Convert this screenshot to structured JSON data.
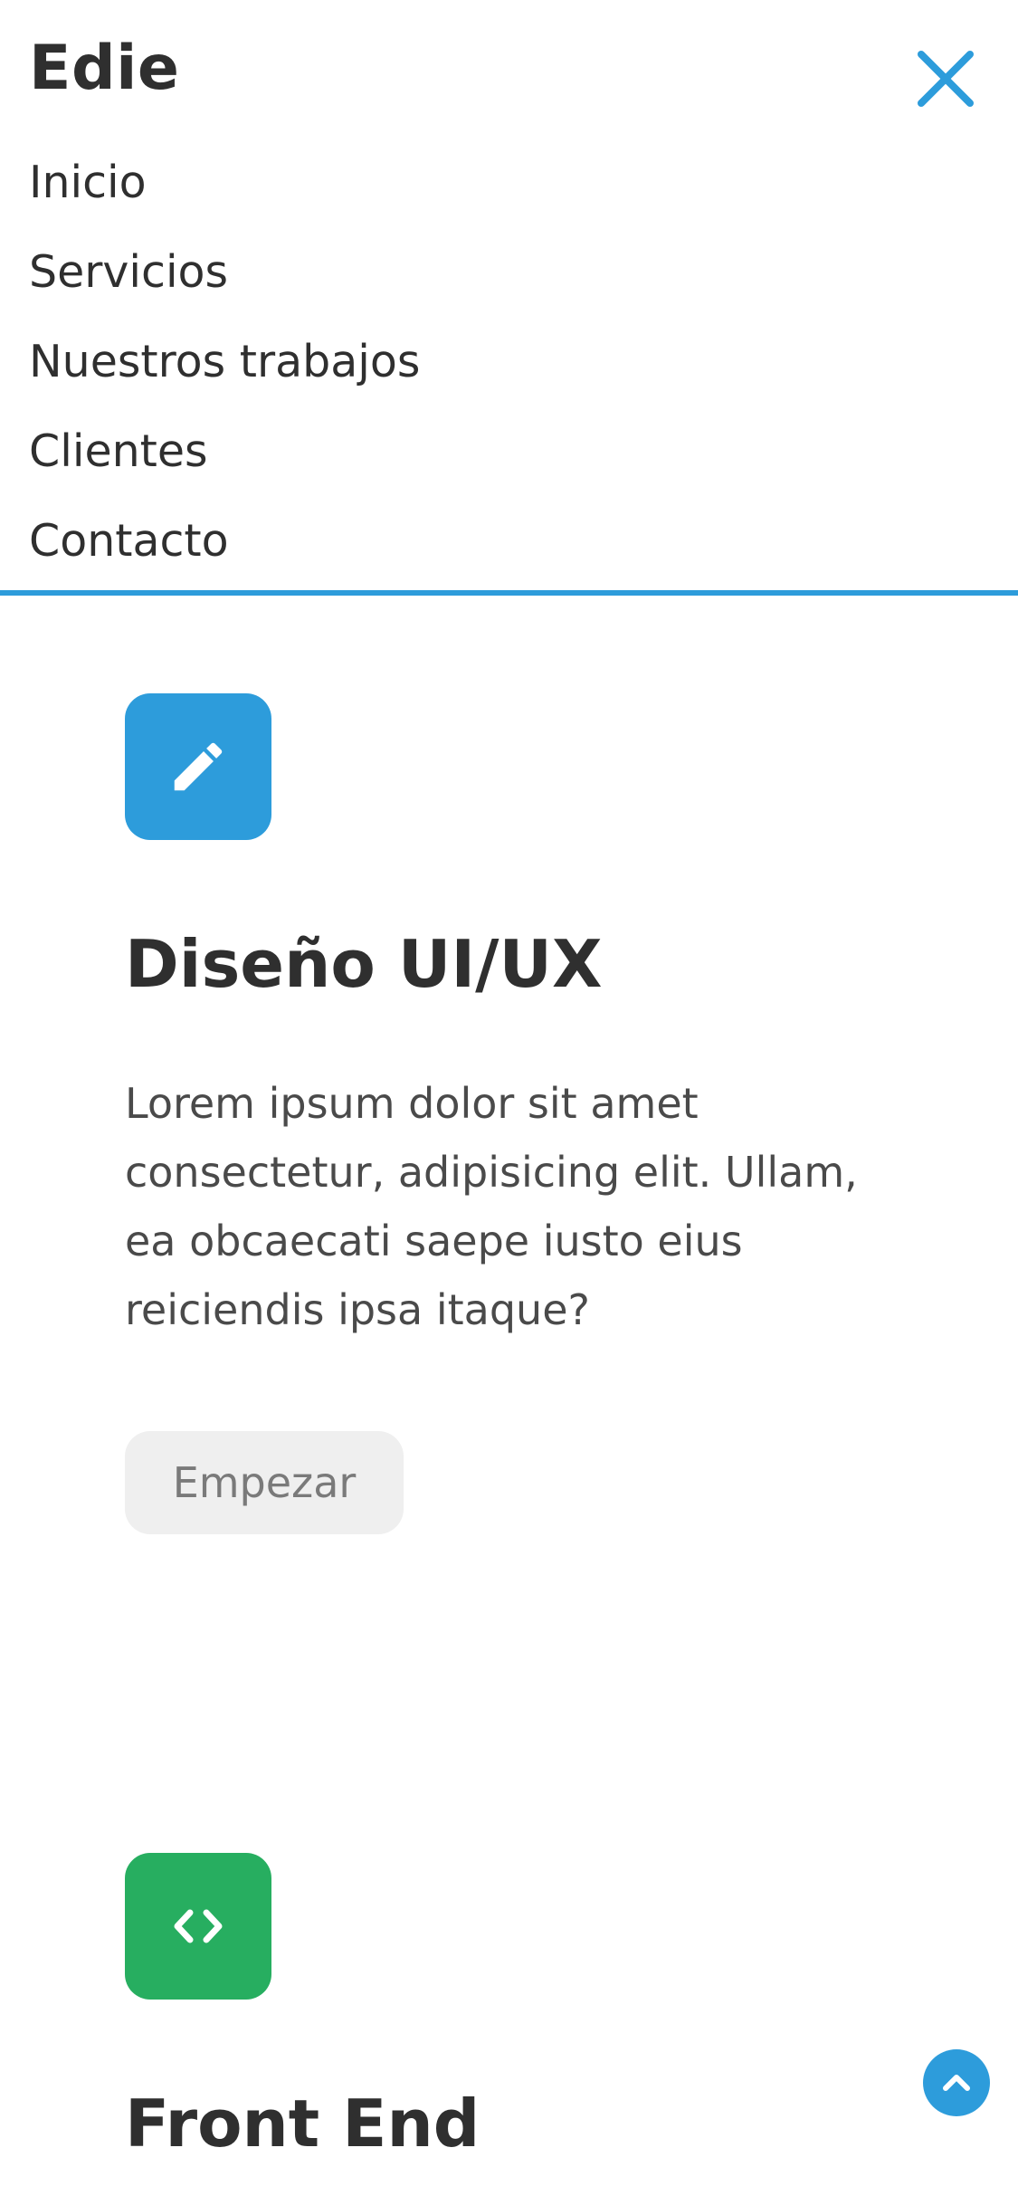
{
  "header": {
    "brand": "Edie",
    "close_icon": "close-icon"
  },
  "nav": {
    "items": [
      {
        "label": "Inicio"
      },
      {
        "label": "Servicios"
      },
      {
        "label": "Nuestros trabajos"
      },
      {
        "label": "Clientes"
      },
      {
        "label": "Contacto"
      }
    ]
  },
  "services": [
    {
      "icon": "pencil-icon",
      "icon_color": "#2d9cdb",
      "title": "Diseño UI/UX",
      "text": "Lorem ipsum dolor sit amet consectetur, adipisicing elit. Ullam, ea obcaecati saepe iusto eius reiciendis ipsa itaque?",
      "button": "Empezar"
    },
    {
      "icon": "code-icon",
      "icon_color": "#27ae60",
      "title": "Front End"
    }
  ],
  "scroll_top": {
    "icon": "chevron-up-icon",
    "color": "#2d9cdb"
  },
  "colors": {
    "accent": "#2d9cdb",
    "green": "#27ae60",
    "text": "#2f2f2f"
  }
}
